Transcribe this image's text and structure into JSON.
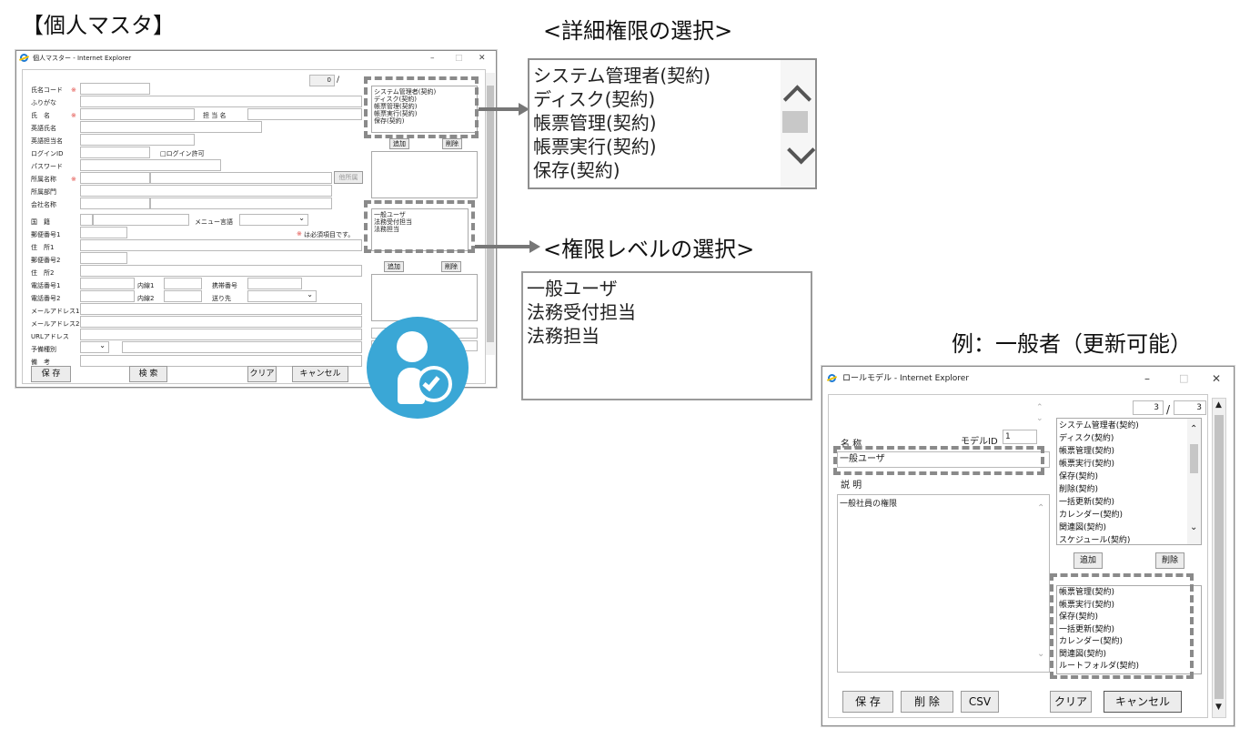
{
  "headings": {
    "personal_master": "【個人マスタ】",
    "detail_select": "<詳細権限の選択>",
    "level_select": "<権限レベルの選択>",
    "example": "例：一般者（更新可能）"
  },
  "colors": {
    "accent_icon": "#3aa7d6",
    "required_mark": "#e0403a",
    "dash": "#8a8a8a"
  },
  "personal_window": {
    "title": "個人マスター - Internet Explorer",
    "page_value": "0",
    "page_sep": "/",
    "labels": {
      "name_code": "氏名コード",
      "furigana": "ふりがな",
      "name": "氏　名",
      "staff_name": "担 当 名",
      "name_en": "英語氏名",
      "staff_en": "英語担当名",
      "login_id": "ログインID",
      "login_allow": "□ログイン許可",
      "password": "パスワード",
      "org_name": "所属名称",
      "other_org": "他所属",
      "org_dept": "所属部門",
      "company": "会社名称",
      "country": "国　籍",
      "menu_lang": "メニュー言語",
      "required_note": "は必須項目です。",
      "zip1": "郵便番号1",
      "addr1": "住　所1",
      "zip2": "郵便番号2",
      "addr2": "住　所2",
      "tel1": "電話番号1",
      "ext1": "内線1",
      "mobile": "携帯番号",
      "tel2": "電話番号2",
      "ext2": "内線2",
      "send_to": "送り先",
      "mail1": "メールアドレス1",
      "mail2": "メールアドレス2",
      "url": "URLアドレス",
      "reserve": "予備種別",
      "note": "備　考"
    },
    "required_mark": "※",
    "detail_list": [
      "システム管理者(契約)",
      "ディスク(契約)",
      "帳票管理(契約)",
      "帳票実行(契約)",
      "保存(契約)"
    ],
    "add_label": "追加",
    "delete_label": "削除",
    "level_list": [
      "一般ユーザ",
      "法務受付担当",
      "法務担当"
    ],
    "buttons": {
      "save": "保 存",
      "search": "検 索",
      "clear": "クリア",
      "cancel": "キャンセル"
    }
  },
  "zoom_detail": {
    "items": [
      "システム管理者(契約)",
      "ディスク(契約)",
      "帳票管理(契約)",
      "帳票実行(契約)",
      "保存(契約)"
    ]
  },
  "zoom_level": {
    "items": [
      "一般ユーザ",
      "法務受付担当",
      "法務担当"
    ]
  },
  "role_window": {
    "title": "ロールモデル - Internet Explorer",
    "page_current": "3",
    "page_sep": "/",
    "page_total": "3",
    "name_label": "名 称",
    "model_id_label": "モデルID",
    "model_id_value": "1",
    "name_value": "一般ユーザ",
    "desc_label": "説 明",
    "desc_value": "一般社員の権限",
    "available_list": [
      "システム管理者(契約)",
      "ディスク(契約)",
      "帳票管理(契約)",
      "帳票実行(契約)",
      "保存(契約)",
      "削除(契約)",
      "一括更新(契約)",
      "カレンダー(契約)",
      "関連図(契約)",
      "スケジュール(契約)"
    ],
    "selected_list": [
      "帳票管理(契約)",
      "帳票実行(契約)",
      "保存(契約)",
      "一括更新(契約)",
      "カレンダー(契約)",
      "関連図(契約)",
      "ルートフォルダ(契約)"
    ],
    "add_label": "追加",
    "delete_label": "削除",
    "buttons": {
      "save": "保 存",
      "delete": "削 除",
      "csv": "CSV",
      "clear": "クリア",
      "cancel": "キャンセル"
    }
  }
}
